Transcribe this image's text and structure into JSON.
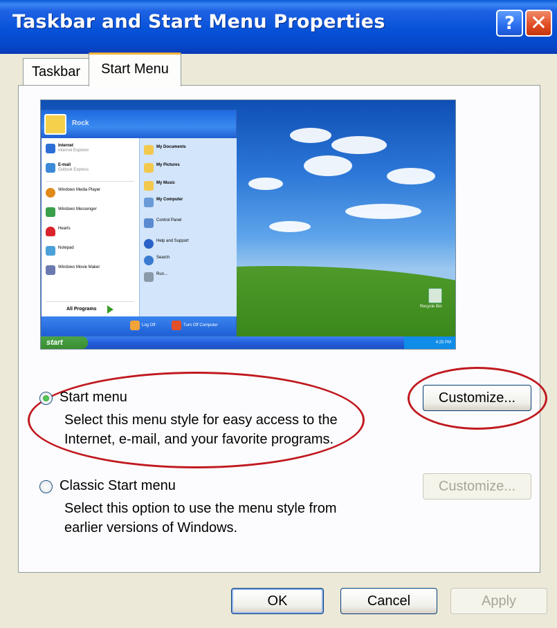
{
  "window": {
    "title": "Taskbar and Start Menu Properties",
    "help_glyph": "?",
    "close_glyph": "✕"
  },
  "tabs": [
    {
      "label": "Taskbar"
    },
    {
      "label": "Start Menu",
      "selected": true
    }
  ],
  "preview": {
    "user": "Rock",
    "left_items": [
      {
        "title": "Internet",
        "subtitle": "Internet Explorer",
        "icon": "ie-icon",
        "color": "#2b6fd6"
      },
      {
        "title": "E-mail",
        "subtitle": "Outlook Express",
        "icon": "mail-icon",
        "color": "#3a8ad8"
      },
      {
        "title": "Windows Media Player",
        "icon": "media-player-icon",
        "color": "#e08a1a"
      },
      {
        "title": "Windows Messenger",
        "icon": "messenger-icon",
        "color": "#3aa04a"
      },
      {
        "title": "Hearts",
        "icon": "hearts-icon",
        "color": "#d8242a"
      },
      {
        "title": "Notepad",
        "icon": "notepad-icon",
        "color": "#4aa0d8"
      },
      {
        "title": "Windows Movie Maker",
        "icon": "movie-maker-icon",
        "color": "#6a7ab0"
      }
    ],
    "all_programs": "All Programs",
    "right_items": [
      {
        "title": "My Documents",
        "icon": "folder-icon",
        "color": "#f2c94c"
      },
      {
        "title": "My Pictures",
        "icon": "folder-icon",
        "color": "#f2c94c"
      },
      {
        "title": "My Music",
        "icon": "folder-icon",
        "color": "#f2c94c"
      },
      {
        "title": "My Computer",
        "icon": "computer-icon",
        "color": "#6a9ad8"
      },
      {
        "title": "Control Panel",
        "icon": "control-panel-icon",
        "color": "#5a8ad0"
      },
      {
        "title": "Help and Support",
        "icon": "help-icon",
        "color": "#2a62c8"
      },
      {
        "title": "Search",
        "icon": "search-icon",
        "color": "#3a7ad0"
      },
      {
        "title": "Run...",
        "icon": "run-icon",
        "color": "#8a9aa8"
      }
    ],
    "log_off": "Log Off",
    "turn_off": "Turn Off Computer",
    "start_label": "start",
    "recycle_bin": "Recycle Bin",
    "clock": "4:25 PM"
  },
  "options": {
    "start_menu": {
      "label": "Start menu",
      "desc1": "Select this menu style for easy access to the",
      "desc2": "Internet, e-mail, and your favorite programs.",
      "customize": "Customize...",
      "selected": true
    },
    "classic": {
      "label": "Classic Start menu",
      "desc1": "Select this option to use the menu style from",
      "desc2": "earlier versions of Windows.",
      "customize": "Customize...",
      "selected": false
    }
  },
  "buttons": {
    "ok": "OK",
    "cancel": "Cancel",
    "apply": "Apply"
  },
  "colors": {
    "title_bar": "#0652d8",
    "highlight": "#c0191f",
    "selected_tab_accent": "#f8b33a"
  }
}
